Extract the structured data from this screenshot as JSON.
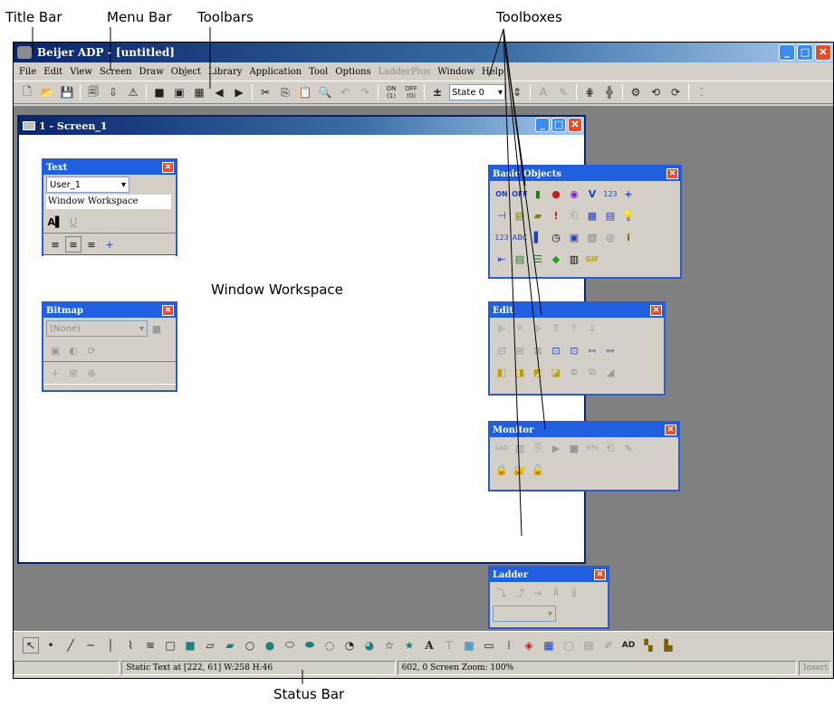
{
  "callouts": {
    "title_bar": "Title Bar",
    "menu_bar": "Menu Bar",
    "toolbars": "Toolbars",
    "toolboxes": "Toolboxes",
    "status_bar": "Status Bar"
  },
  "app": {
    "title": "Beijer ADP - [untitled]"
  },
  "menu": [
    "File",
    "Edit",
    "View",
    "Screen",
    "Draw",
    "Object",
    "Library",
    "Application",
    "Tool",
    "Options",
    "LadderPlus",
    "Window",
    "Help"
  ],
  "toolbar": {
    "on_label": "ON\n(1)",
    "off_label": "OFF\n(0)",
    "state_value": "State 0"
  },
  "screen_window": {
    "title": "1 - Screen_1",
    "workspace_label": "Window Workspace"
  },
  "toolboxes": {
    "text": {
      "title": "Text",
      "user_value": "User_1",
      "text_value": "Window Workspace"
    },
    "bitmap": {
      "title": "Bitmap",
      "combo_value": "(None)"
    },
    "basic_objects": {
      "title": "Basic Objects",
      "on_label": "ON",
      "off_label": "OFF"
    },
    "edit": {
      "title": "Edit"
    },
    "monitor": {
      "title": "Monitor"
    },
    "ladder": {
      "title": "Ladder"
    }
  },
  "statusbar": {
    "object_info": "Static Text at [222, 61] W:258 H:46",
    "coords_zoom": "602, 0  Screen Zoom: 100%",
    "mode": "Insert"
  }
}
